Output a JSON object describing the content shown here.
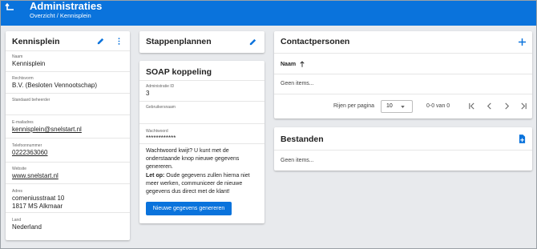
{
  "header": {
    "title": "Administraties",
    "breadcrumb": "Overzicht / Kennisplein"
  },
  "left_card": {
    "title": "Kennisplein",
    "fields": [
      {
        "label": "Naam",
        "value": "Kennisplein"
      },
      {
        "label": "Rechtsvorm",
        "value": "B.V. (Besloten Vennootschap)"
      },
      {
        "label": "Standaard beheerder",
        "value": ""
      },
      {
        "label": "E-mailadres",
        "value": "kennisplein@snelstart.nl"
      },
      {
        "label": "Telefoonnummer",
        "value": "0222363060"
      },
      {
        "label": "Website",
        "value": "www.snelstart.nl"
      },
      {
        "label": "Adres",
        "value_line1": "comeniusstraat 10",
        "value_line2": "1817 MS Alkmaar"
      },
      {
        "label": "Land",
        "value": "Nederland"
      }
    ]
  },
  "stappen_card": {
    "title": "Stappenplannen"
  },
  "soap_card": {
    "title": "SOAP koppeling",
    "admin_id_label": "Administratie ID",
    "admin_id_value": "3",
    "username_label": "Gebruikersnaam",
    "password_label": "Wachtwoord",
    "password_value": "************",
    "forgot_text": "Wachtwoord kwijt? U kunt met de onderstaande knop nieuwe gegevens genereren.",
    "note_bold": "Let op:",
    "note_text": " Oude gegevens zullen hierna niet meer werken, communiceer de nieuwe gegevens dus direct met de klant!",
    "button_label": "Nieuwe gegevens genereren"
  },
  "contact_card": {
    "title": "Contactpersonen",
    "column_header": "Naam",
    "empty_text": "Geen items...",
    "rows_per_page_label": "Rijen per pagina",
    "rows_per_page_value": "10",
    "range_text": "0-0 van 0"
  },
  "files_card": {
    "title": "Bestanden",
    "empty_text": "Geen items..."
  },
  "colors": {
    "primary": "#0a73dc",
    "background": "#e8eaed"
  }
}
